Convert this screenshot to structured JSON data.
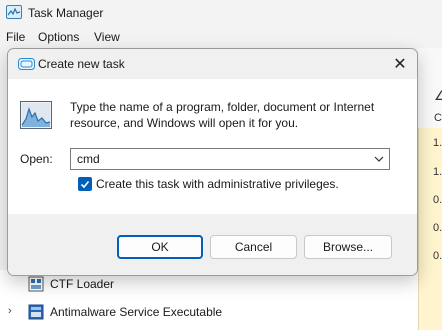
{
  "task_manager": {
    "title": "Task Manager",
    "menu": [
      "File",
      "Options",
      "View"
    ],
    "right_column_values": [
      "1.",
      "1.",
      "0.",
      "0.",
      "0."
    ],
    "processes": [
      {
        "name": "CTF Loader",
        "expandable": false
      },
      {
        "name": "Antimalware Service Executable",
        "expandable": true
      }
    ]
  },
  "dialog": {
    "title": "Create new task",
    "close_glyph": "✕",
    "description": "Type the name of a program, folder, document or Internet resource, and Windows will open it for you.",
    "open_label": "Open:",
    "open_value": "cmd",
    "admin_checkbox": {
      "label": "Create this task with administrative privileges.",
      "checked": true
    },
    "buttons": {
      "ok": "OK",
      "cancel": "Cancel",
      "browse": "Browse..."
    }
  },
  "colors": {
    "accent": "#005fb8",
    "dialog_body": "#ffffff",
    "dialog_chrome": "#f0f0f0",
    "highlight_panel": "#fff4ce"
  }
}
